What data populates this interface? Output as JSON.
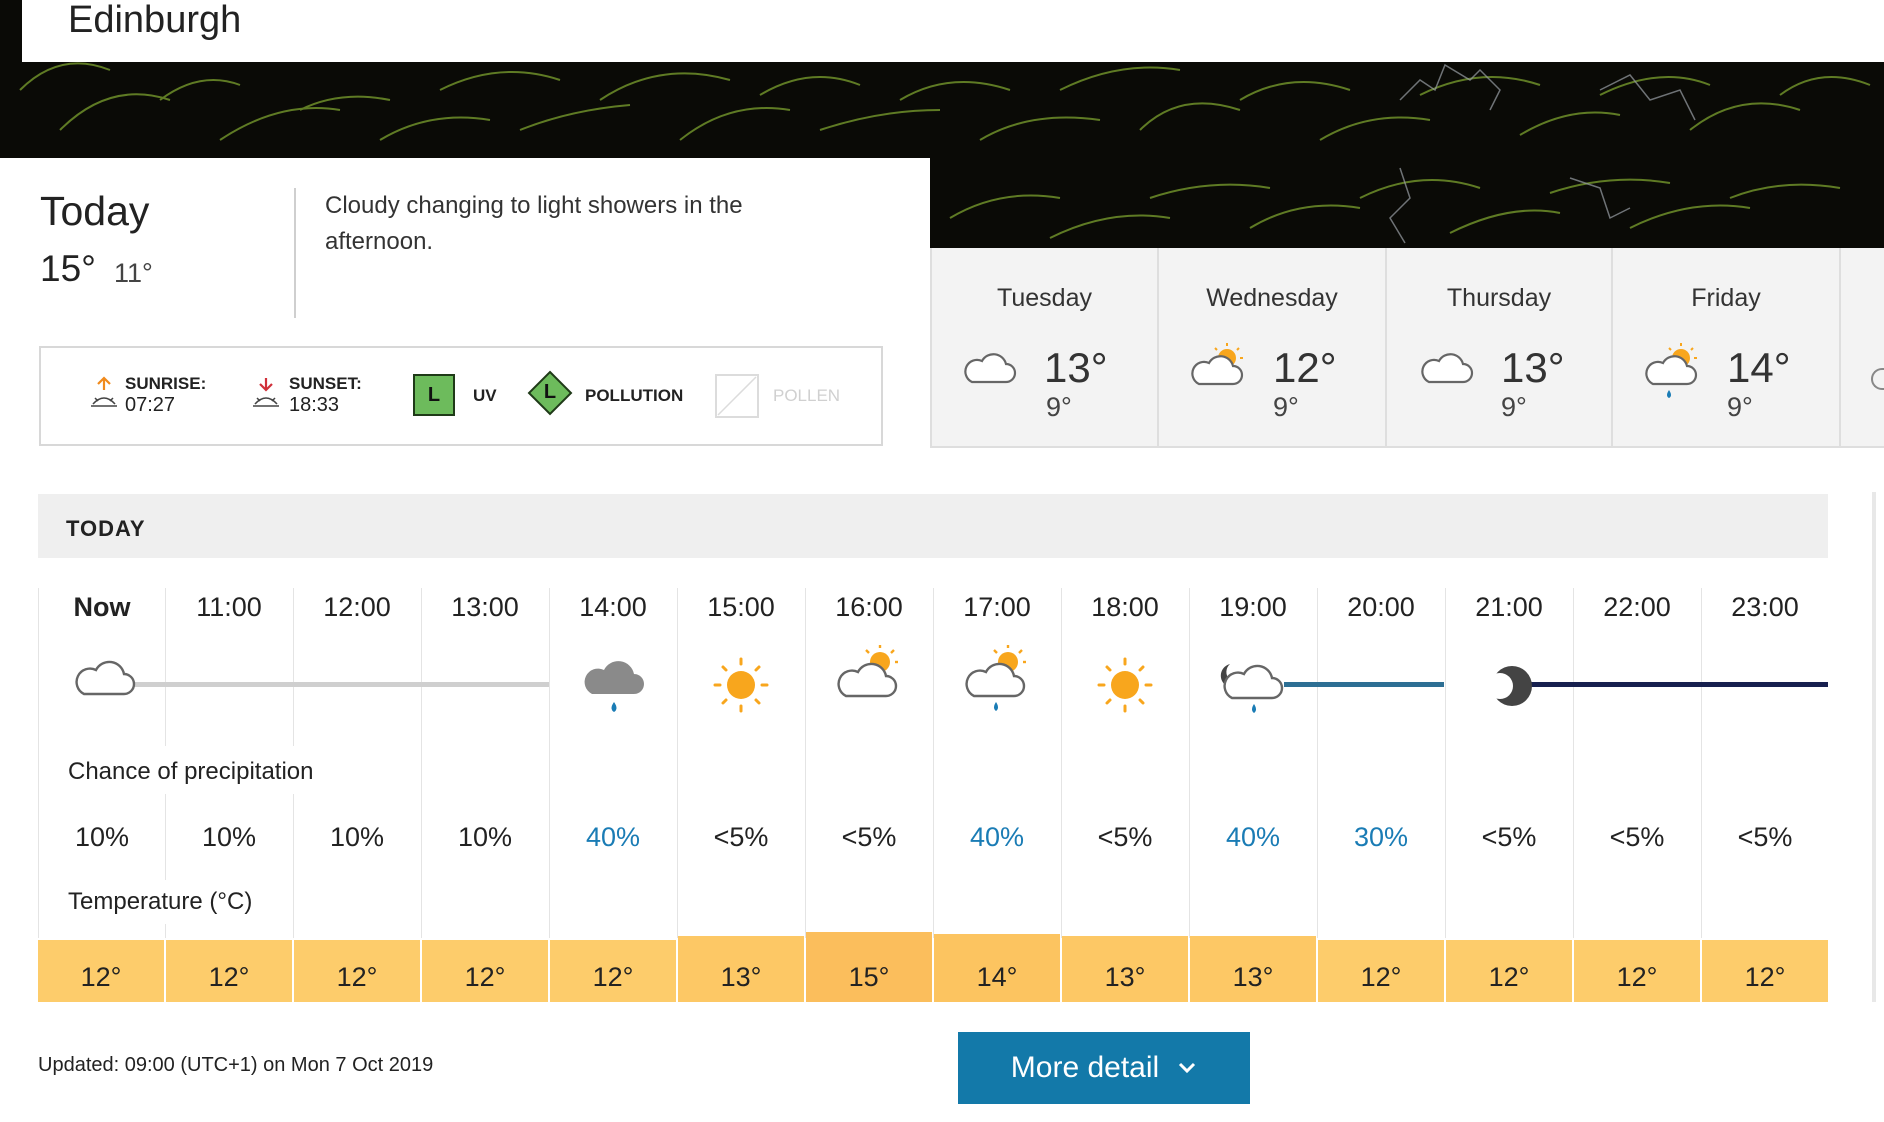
{
  "location": "Edinburgh",
  "today": {
    "title": "Today",
    "high": "15°",
    "low": "11°",
    "summary": "Cloudy changing to light showers in the afternoon.",
    "sunrise_label": "SUNRISE:",
    "sunrise_time": "07:27",
    "sunset_label": "SUNSET:",
    "sunset_time": "18:33",
    "uv_level": "L",
    "uv_label": "UV",
    "pollution_level": "L",
    "pollution_label": "POLLUTION",
    "pollen_label": "POLLEN"
  },
  "days": [
    {
      "name": "Tuesday",
      "high": "13°",
      "low": "9°",
      "icon": "cloud-icon"
    },
    {
      "name": "Wednesday",
      "high": "12°",
      "low": "9°",
      "icon": "sunny-intervals-icon"
    },
    {
      "name": "Thursday",
      "high": "13°",
      "low": "9°",
      "icon": "cloud-icon"
    },
    {
      "name": "Friday",
      "high": "14°",
      "low": "9°",
      "icon": "light-shower-day-icon"
    }
  ],
  "hourly": {
    "header": "TODAY",
    "precip_label": "Chance of precipitation",
    "temp_label": "Temperature (°C)",
    "times": [
      "Now",
      "11:00",
      "12:00",
      "13:00",
      "14:00",
      "15:00",
      "16:00",
      "17:00",
      "18:00",
      "19:00",
      "20:00",
      "21:00",
      "22:00",
      "23:00"
    ],
    "icons": [
      "cloud-icon",
      "",
      "",
      "",
      "heavy-shower-icon",
      "sun-icon",
      "sunny-intervals-icon",
      "light-shower-day-icon",
      "sun-icon",
      "light-shower-night-icon",
      "",
      "clear-night-icon",
      "",
      ""
    ],
    "precip": [
      "10%",
      "10%",
      "10%",
      "10%",
      "40%",
      "<5%",
      "<5%",
      "40%",
      "<5%",
      "40%",
      "30%",
      "<5%",
      "<5%",
      "<5%"
    ],
    "temps": [
      "12°",
      "12°",
      "12°",
      "12°",
      "12°",
      "13°",
      "15°",
      "14°",
      "13°",
      "13°",
      "12°",
      "12°",
      "12°",
      "12°"
    ]
  },
  "updated": "Updated: 09:00 (UTC+1) on Mon 7 Oct 2019",
  "more_detail": "More detail",
  "colors": {
    "accent_blue": "#1379a9",
    "precip_blue": "#1a7cb5",
    "temp_bar": "#fdcc6b",
    "temp_bar_warm": "#fbbe5c",
    "uv_green": "#6dbb5c",
    "night_line": "#17204f",
    "dusk_line": "#2d6f94"
  }
}
